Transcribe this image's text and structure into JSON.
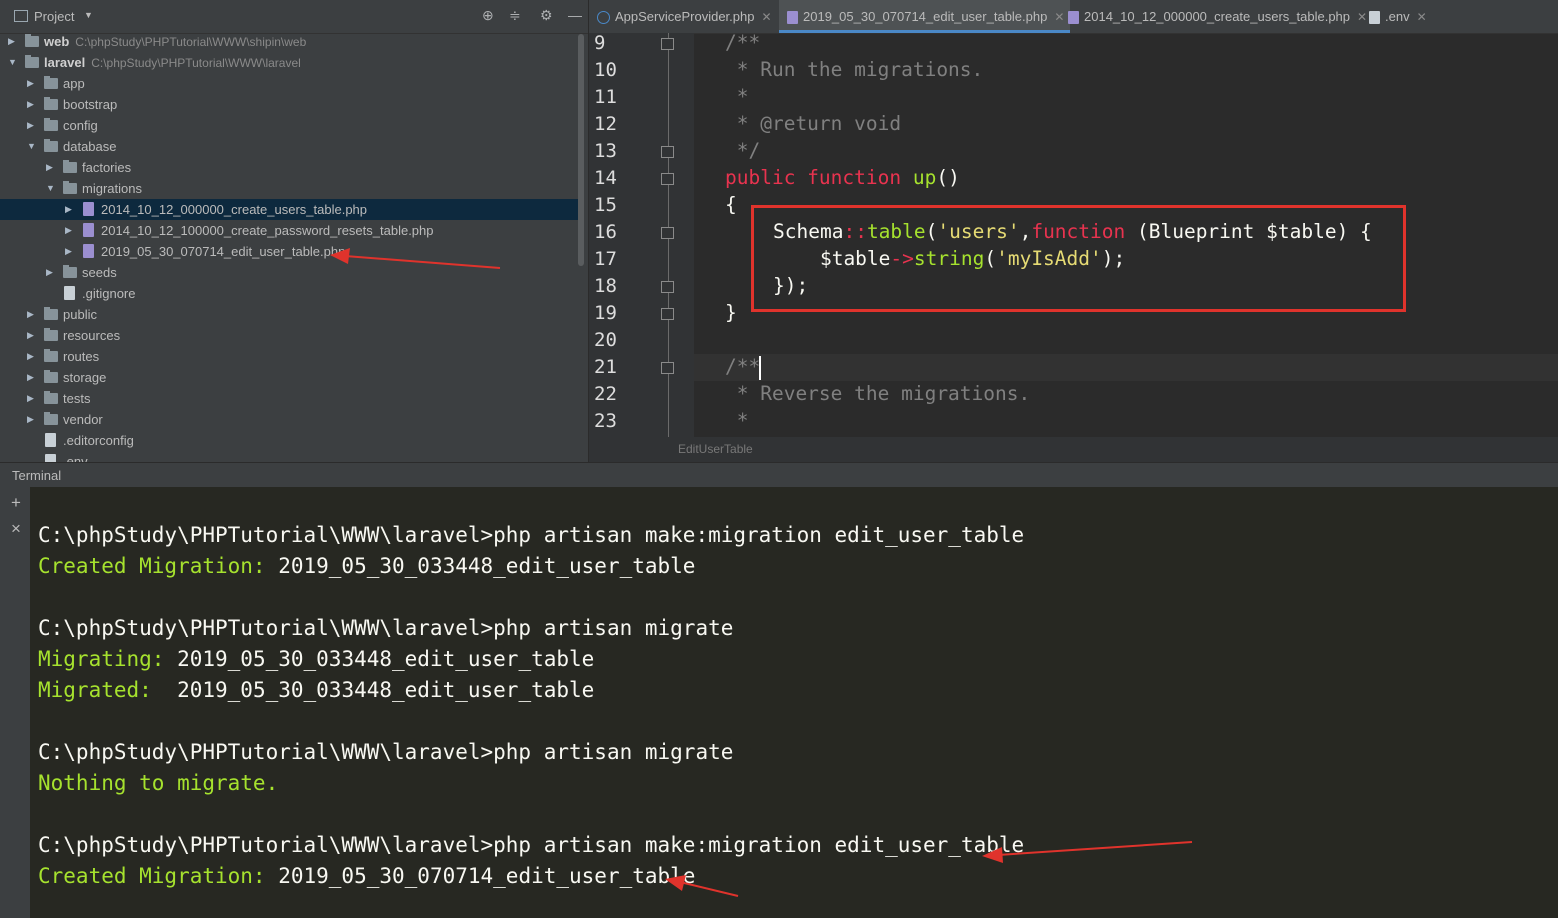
{
  "project_panel": {
    "title": "Project",
    "tree": [
      {
        "label": "web",
        "path": "C:\\phpStudy\\PHPTutorial\\WWW\\shipin\\web",
        "kind": "folder",
        "depth": 0,
        "expanded": false,
        "bold": true
      },
      {
        "label": "laravel",
        "path": "C:\\phpStudy\\PHPTutorial\\WWW\\laravel",
        "kind": "folder",
        "depth": 0,
        "expanded": true,
        "bold": true
      },
      {
        "label": "app",
        "kind": "folder",
        "depth": 1,
        "expanded": false
      },
      {
        "label": "bootstrap",
        "kind": "folder",
        "depth": 1,
        "expanded": false
      },
      {
        "label": "config",
        "kind": "folder",
        "depth": 1,
        "expanded": false
      },
      {
        "label": "database",
        "kind": "folder",
        "depth": 1,
        "expanded": true
      },
      {
        "label": "factories",
        "kind": "folder",
        "depth": 2,
        "expanded": false
      },
      {
        "label": "migrations",
        "kind": "folder",
        "depth": 2,
        "expanded": true
      },
      {
        "label": "2014_10_12_000000_create_users_table.php",
        "kind": "php",
        "depth": 3,
        "expanded": false,
        "selected": true
      },
      {
        "label": "2014_10_12_100000_create_password_resets_table.php",
        "kind": "php",
        "depth": 3,
        "expanded": false
      },
      {
        "label": "2019_05_30_070714_edit_user_table.php",
        "kind": "php",
        "depth": 3,
        "expanded": false
      },
      {
        "label": "seeds",
        "kind": "folder",
        "depth": 2,
        "expanded": false
      },
      {
        "label": ".gitignore",
        "kind": "file",
        "depth": 2
      },
      {
        "label": "public",
        "kind": "folder",
        "depth": 1,
        "expanded": false
      },
      {
        "label": "resources",
        "kind": "folder",
        "depth": 1,
        "expanded": false
      },
      {
        "label": "routes",
        "kind": "folder",
        "depth": 1,
        "expanded": false
      },
      {
        "label": "storage",
        "kind": "folder",
        "depth": 1,
        "expanded": false
      },
      {
        "label": "tests",
        "kind": "folder",
        "depth": 1,
        "expanded": false
      },
      {
        "label": "vendor",
        "kind": "folder",
        "depth": 1,
        "expanded": false
      },
      {
        "label": ".editorconfig",
        "kind": "file",
        "depth": 1
      },
      {
        "label": ".env",
        "kind": "file",
        "depth": 1
      }
    ]
  },
  "editor": {
    "tabs": [
      {
        "label": "AppServiceProvider.php",
        "icon": "class-icon"
      },
      {
        "label": "2019_05_30_070714_edit_user_table.php",
        "icon": "php-file-icon",
        "active": true
      },
      {
        "label": "2014_10_12_000000_create_users_table.php",
        "icon": "php-file-icon"
      },
      {
        "label": ".env",
        "icon": "env-file-icon"
      }
    ],
    "line_numbers": [
      "9",
      "10",
      "11",
      "12",
      "13",
      "14",
      "15",
      "16",
      "17",
      "18",
      "19",
      "20",
      "21",
      "22",
      "23"
    ],
    "lines": {
      "l9": "/**",
      "l10": " * Run the migrations.",
      "l11": " *",
      "l12": " * @return void",
      "l13": " */",
      "l14_kw": "public function ",
      "l14_fn": "up",
      "l14_rest": "()",
      "l15": "{",
      "l16_a": "Schema",
      "l16_b": "::",
      "l16_c": "table",
      "l16_d": "(",
      "l16_e": "'users'",
      "l16_f": ",",
      "l16_g": "function",
      "l16_h": " (Blueprint $table) {",
      "l17_a": "    $table",
      "l17_b": "->",
      "l17_c": "string",
      "l17_d": "(",
      "l17_e": "'myIsAdd'",
      "l17_f": ");",
      "l18": "});",
      "l19": "}",
      "l21": "/**",
      "l22": " * Reverse the migrations.",
      "l23": " *"
    },
    "breadcrumb": "EditUserTable",
    "highlight_color": "#e0332c"
  },
  "terminal": {
    "title": "Terminal",
    "add_label": "+",
    "close_label": "×",
    "lines": [
      {
        "prompt": "C:\\phpStudy\\PHPTutorial\\WWW\\laravel>php artisan make:migration edit_user_table"
      },
      {
        "label": "Created Migration:",
        "value": " 2019_05_30_033448_edit_user_table"
      },
      {
        "prompt": "C:\\phpStudy\\PHPTutorial\\WWW\\laravel>php artisan migrate"
      },
      {
        "label": "Migrating:",
        "value": " 2019_05_30_033448_edit_user_table"
      },
      {
        "label": "Migrated:",
        "value": "  2019_05_30_033448_edit_user_table"
      },
      {
        "prompt": "C:\\phpStudy\\PHPTutorial\\WWW\\laravel>php artisan migrate"
      },
      {
        "label": "Nothing to migrate.",
        "value": ""
      },
      {
        "prompt": "C:\\phpStudy\\PHPTutorial\\WWW\\laravel>php artisan make:migration edit_user_table"
      },
      {
        "label": "Created Migration:",
        "value": " 2019_05_30_070714_edit_user_table"
      }
    ]
  },
  "annotation_color": "#e0332c"
}
